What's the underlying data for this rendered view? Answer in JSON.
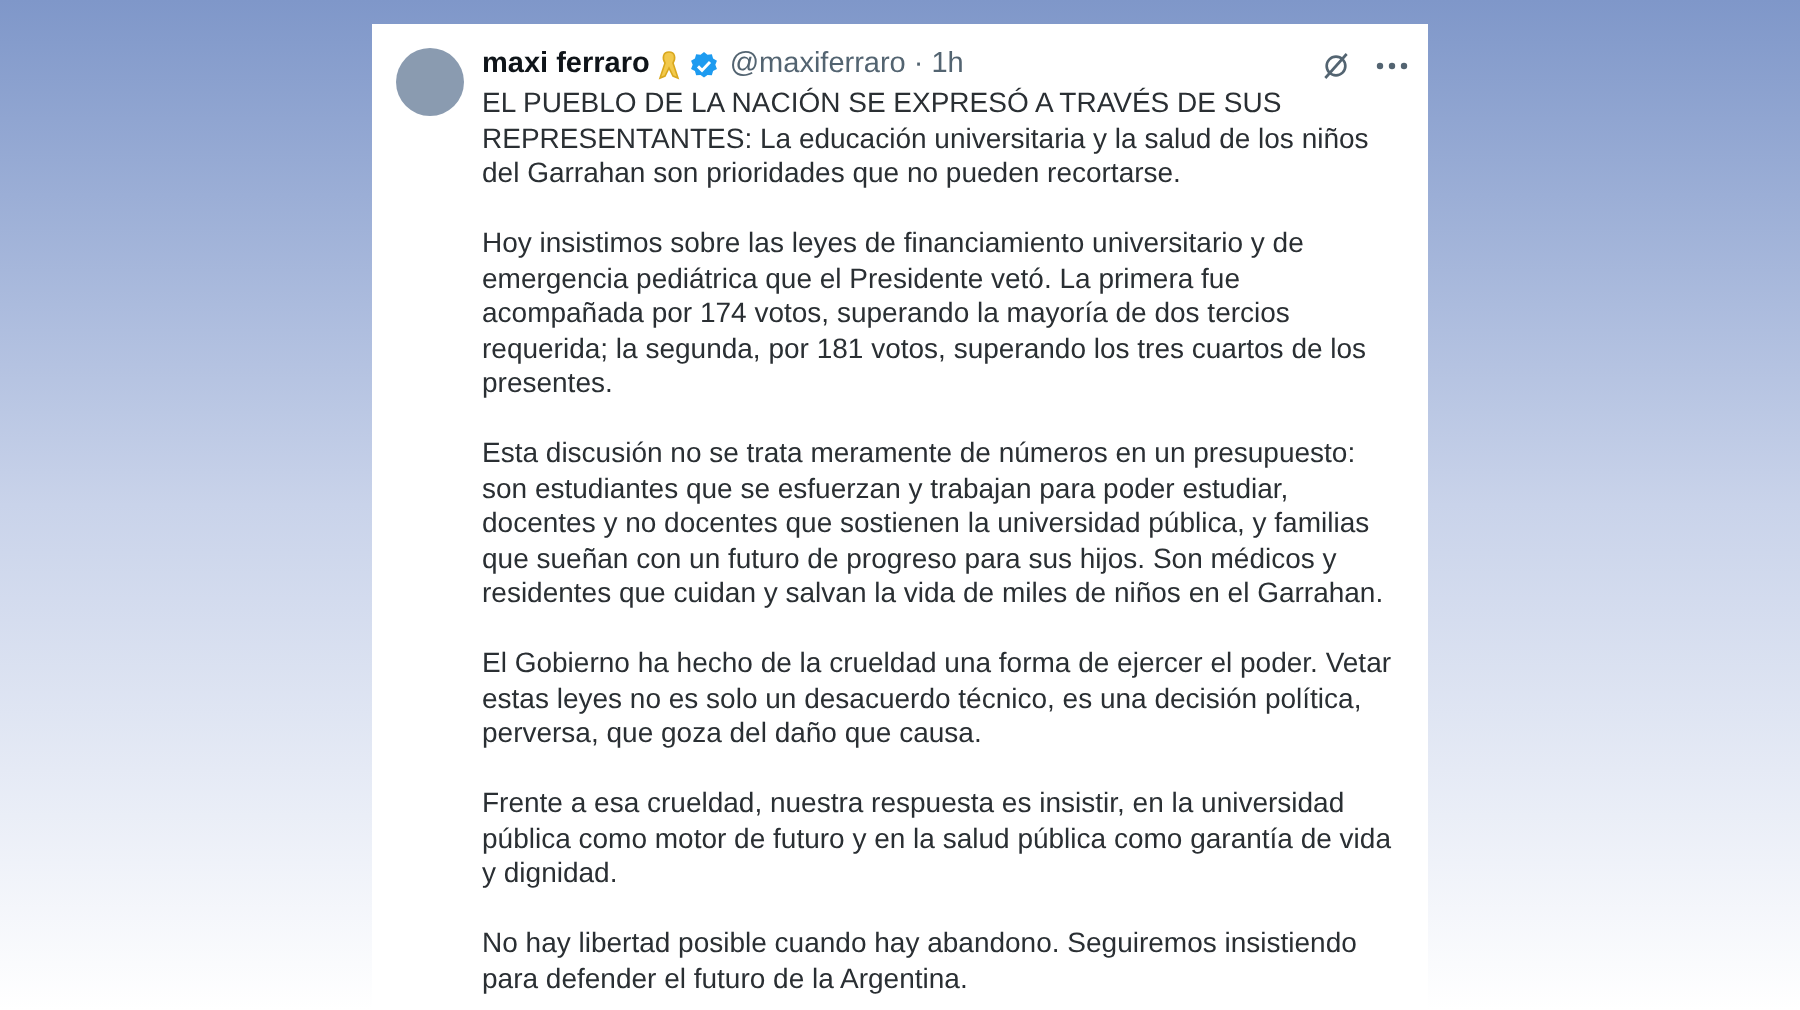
{
  "post": {
    "author_name": "maxi ferraro",
    "handle": "@maxiferraro",
    "separator": "·",
    "time": "1h",
    "verified": true,
    "paragraphs": [
      "EL PUEBLO DE LA NACIÓN SE EXPRESÓ A TRAVÉS DE SUS REPRESENTANTES: La educación universitaria y la salud de los niños del Garrahan son prioridades que no pueden recortarse.",
      "Hoy insistimos sobre las leyes de financiamiento universitario y de emergencia pediátrica que el Presidente vetó. La primera fue acompañada por 174 votos, superando la mayoría de dos tercios requerida; la segunda, por 181 votos, superando los tres cuartos de los presentes.",
      "Esta discusión no se trata meramente de números en un presupuesto: son estudiantes que se esfuerzan y trabajan para poder estudiar, docentes y no docentes que sostienen la universidad pública, y familias que sueñan con un futuro de progreso para sus hijos. Son médicos y residentes que cuidan y salvan la vida de miles de niños en el Garrahan.",
      "El Gobierno ha hecho de la crueldad una forma de ejercer el poder. Vetar estas leyes no es solo un desacuerdo técnico, es una decisión política, perversa, que goza del daño que causa.",
      "Frente a esa crueldad, nuestra respuesta es insistir, en la universidad pública como motor de futuro y en la salud pública como garantía de vida y dignidad.",
      "No hay libertad posible cuando hay abandono. Seguiremos insistiendo para defender el futuro de la Argentina."
    ]
  }
}
